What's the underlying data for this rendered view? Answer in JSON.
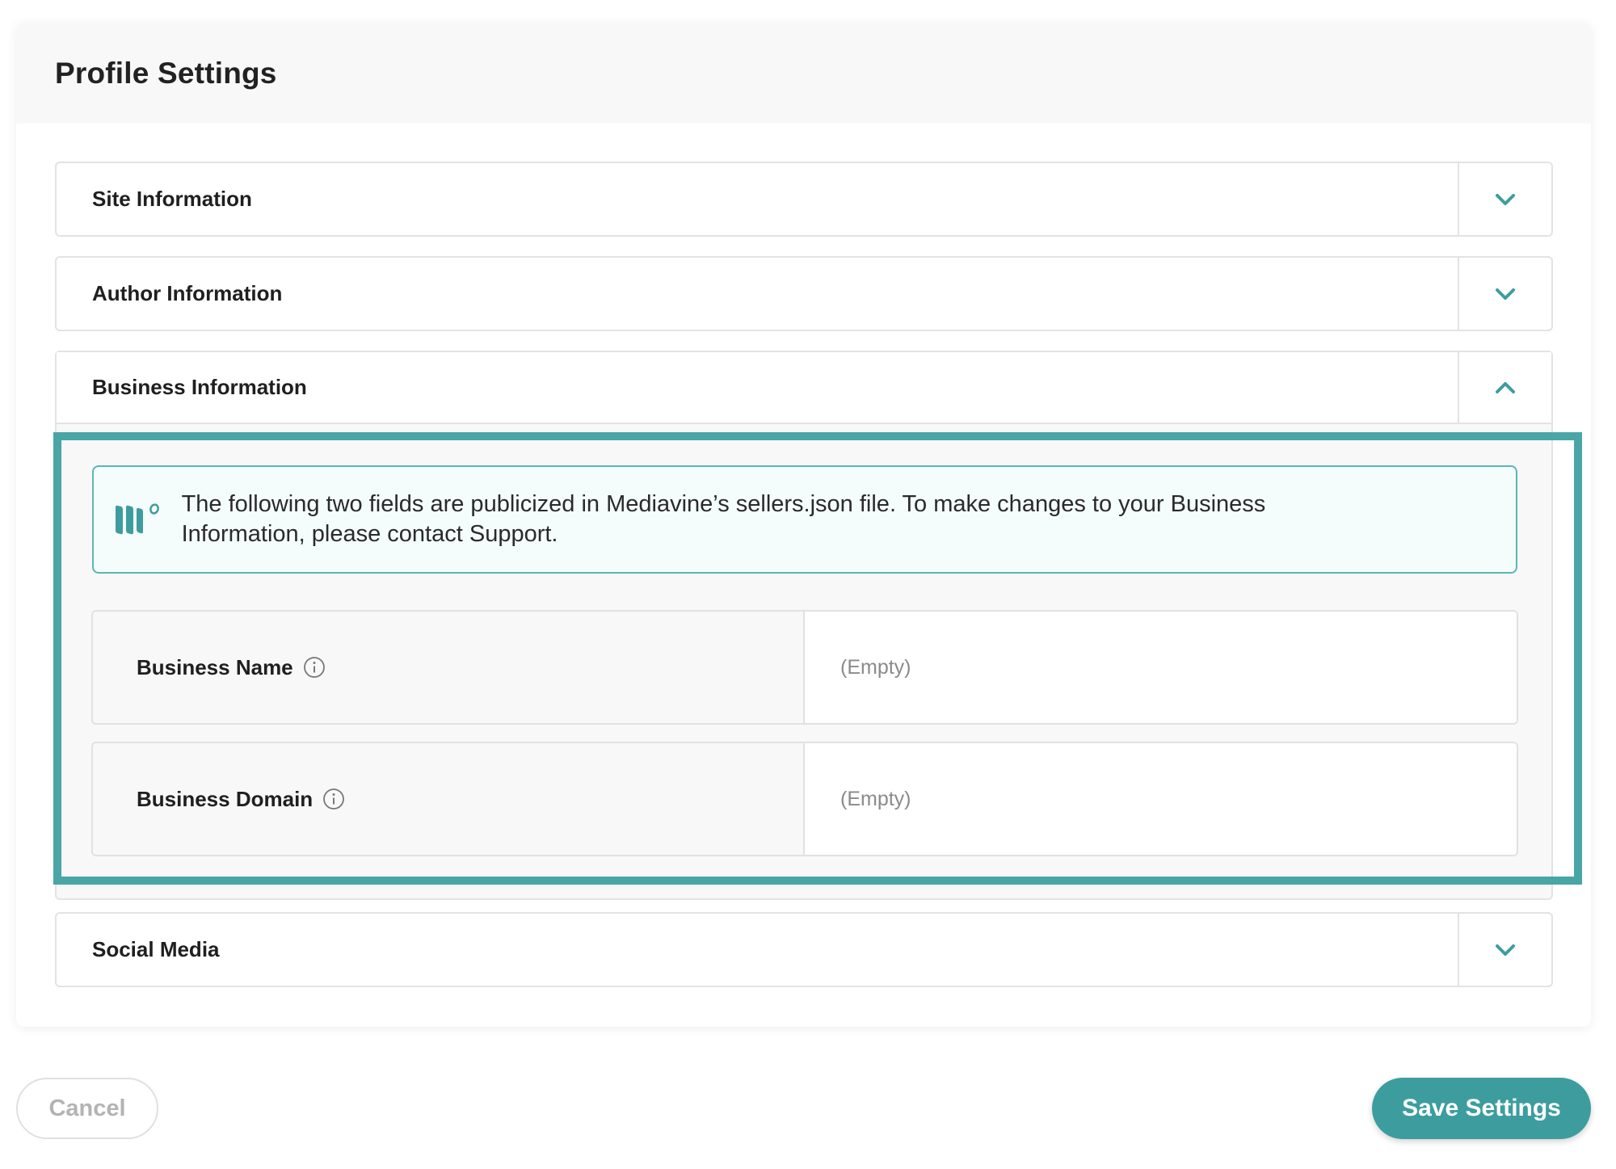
{
  "page": {
    "title": "Profile Settings"
  },
  "sections": [
    {
      "label": "Site Information",
      "state": "collapsed"
    },
    {
      "label": "Author Information",
      "state": "collapsed"
    },
    {
      "label": "Business Information",
      "state": "expanded"
    },
    {
      "label": "Social Media",
      "state": "collapsed"
    }
  ],
  "business": {
    "notice_text": "The following two fields are publicized in Mediavine’s sellers.json file. To make changes to your Business Information, please contact Support.",
    "fields": [
      {
        "label": "Business Name",
        "value": "(Empty)"
      },
      {
        "label": "Business Domain",
        "value": "(Empty)"
      }
    ]
  },
  "actions": {
    "cancel_label": "Cancel",
    "save_label": "Save Settings"
  },
  "colors": {
    "accent": "#3d9d9e",
    "highlight_border": "#4aa5a6",
    "notice_border": "#5bb6b6",
    "notice_bg": "#f5fcfc"
  },
  "icons": {
    "collapsed": "chevron-down-icon",
    "expanded": "chevron-up-icon",
    "notice": "mediavine-logo-icon",
    "field_info": "info-icon"
  }
}
